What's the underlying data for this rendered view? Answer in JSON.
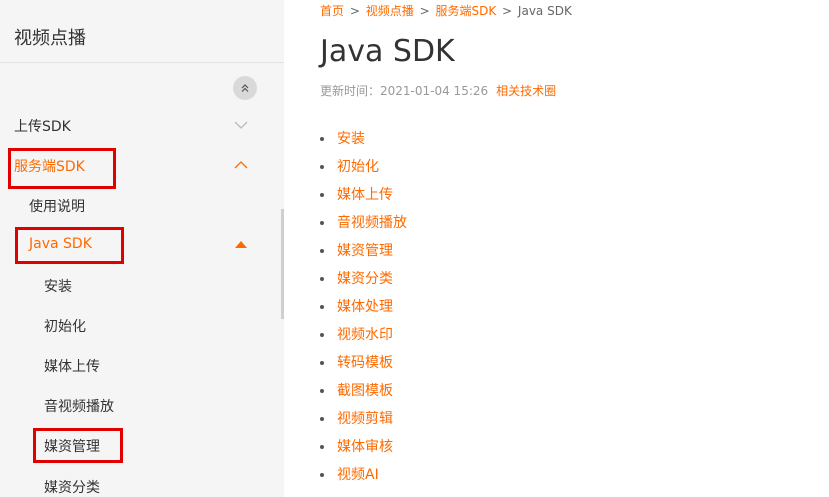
{
  "sidebar": {
    "title": "视频点播",
    "items": [
      {
        "label": "上传SDK"
      },
      {
        "label": "服务端SDK"
      },
      {
        "label": "使用说明"
      },
      {
        "label": "Java SDK"
      },
      {
        "label": "安装"
      },
      {
        "label": "初始化"
      },
      {
        "label": "媒体上传"
      },
      {
        "label": "音视频播放"
      },
      {
        "label": "媒资管理"
      },
      {
        "label": "媒资分类"
      }
    ]
  },
  "breadcrumb": [
    "首页",
    "视频点播",
    "服务端SDK",
    "Java SDK"
  ],
  "page": {
    "title": "Java SDK",
    "updated_label": "更新时间：2021-01-04 15:26",
    "related_link": "相关技术圈"
  },
  "toc": [
    "安装",
    "初始化",
    "媒体上传",
    "音视频播放",
    "媒资管理",
    "媒资分类",
    "媒体处理",
    "视频水印",
    "转码模板",
    "截图模板",
    "视频剪辑",
    "媒体审核",
    "视频AI"
  ],
  "colors": {
    "accent": "#ff6a00",
    "highlight_box": "#e10000",
    "sidebar_bg": "#f5f5f6"
  },
  "icons": {
    "collapse": "double-chevron-up-icon",
    "expand": "chevron-down-icon",
    "collapse_section": "chevron-up-icon",
    "expanded_marker": "triangle-up-icon"
  }
}
